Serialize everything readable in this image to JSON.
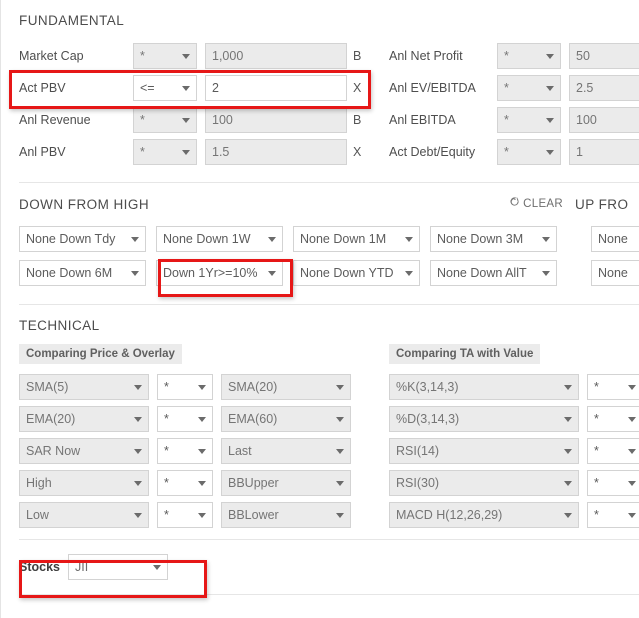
{
  "fundamental": {
    "title": "FUNDAMENTAL",
    "left_rows": [
      {
        "label": "Market Cap",
        "op": "*",
        "value": "1,000",
        "unit": "B",
        "active": false
      },
      {
        "label": "Act PBV",
        "op": "<=",
        "value": "2",
        "unit": "X",
        "active": true
      },
      {
        "label": "Anl Revenue",
        "op": "*",
        "value": "100",
        "unit": "B",
        "active": false
      },
      {
        "label": "Anl PBV",
        "op": "*",
        "value": "1.5",
        "unit": "X",
        "active": false
      }
    ],
    "right_rows": [
      {
        "label": "Anl Net Profit",
        "op": "*",
        "value": "50",
        "unit": "",
        "active": false
      },
      {
        "label": "Anl EV/EBITDA",
        "op": "*",
        "value": "2.5",
        "unit": "",
        "active": false
      },
      {
        "label": "Anl EBITDA",
        "op": "*",
        "value": "100",
        "unit": "",
        "active": false
      },
      {
        "label": "Act Debt/Equity",
        "op": "*",
        "value": "1",
        "unit": "",
        "active": false
      }
    ]
  },
  "down_from_high": {
    "title": "DOWN FROM HIGH",
    "clear_label": "CLEAR",
    "up_from_title": "UP FRO",
    "rows": [
      [
        "None Down Tdy",
        "None Down 1W",
        "None Down 1M",
        "None Down 3M"
      ],
      [
        "None Down 6M",
        "Down 1Yr>=10%",
        "None Down YTD",
        "None Down AllT"
      ]
    ],
    "up_from_rows": [
      "None",
      "None"
    ]
  },
  "technical": {
    "title": "TECHNICAL",
    "left_badge": "Comparing Price & Overlay",
    "right_badge": "Comparing TA with Value",
    "left_rows": [
      {
        "a": "SMA(5)",
        "op": "*",
        "b": "SMA(20)"
      },
      {
        "a": "EMA(20)",
        "op": "*",
        "b": "EMA(60)"
      },
      {
        "a": "SAR Now",
        "op": "*",
        "b": "Last"
      },
      {
        "a": "High",
        "op": "*",
        "b": "BBUpper"
      },
      {
        "a": "Low",
        "op": "*",
        "b": "BBLower"
      }
    ],
    "right_rows": [
      {
        "a": "%K(3,14,3)",
        "op": "*"
      },
      {
        "a": "%D(3,14,3)",
        "op": "*"
      },
      {
        "a": "RSI(14)",
        "op": "*"
      },
      {
        "a": "RSI(30)",
        "op": "*"
      },
      {
        "a": "MACD H(12,26,29)",
        "op": "*"
      }
    ]
  },
  "stocks": {
    "label": "Stocks",
    "value": "JII"
  },
  "colors": {
    "highlight": "#e61717",
    "control_border": "#d3d3d3",
    "control_disabled_bg": "#ebebeb"
  }
}
